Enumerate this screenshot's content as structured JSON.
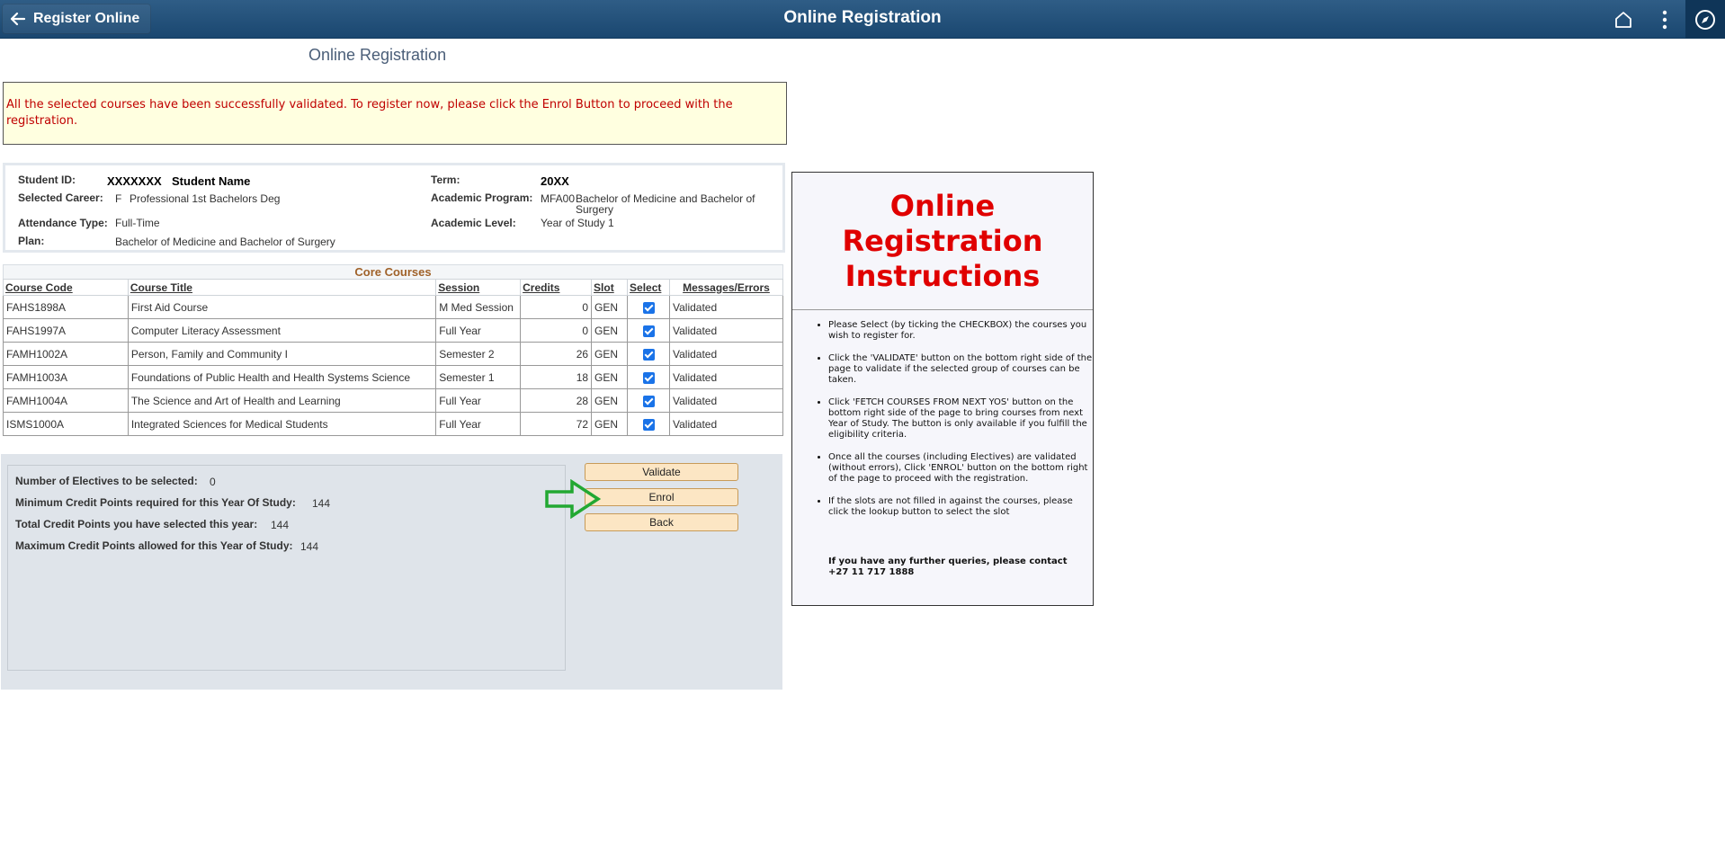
{
  "header": {
    "back_label": "Register Online",
    "title": "Online Registration",
    "icons": [
      "home-icon",
      "more-vertical-icon",
      "compass-icon"
    ]
  },
  "page_title": "Online Registration",
  "message": "All the selected courses have been successfully validated. To register now, please click the Enrol Button to proceed with the registration.",
  "student": {
    "id_label": "Student ID:",
    "id_value": "XXXXXXX",
    "name": "Student Name",
    "career_label": "Selected Career:",
    "career_code": "F",
    "career_value": "Professional 1st Bachelors Deg",
    "attendance_label": "Attendance Type:",
    "attendance_value": "Full-Time",
    "plan_label": "Plan:",
    "plan_value": "Bachelor of Medicine and Bachelor of Surgery",
    "term_label": "Term:",
    "term_value": "20XX",
    "program_label": "Academic Program:",
    "program_code": "MFA00",
    "program_value_line1": "Bachelor of Medicine and Bachelor of",
    "program_value_line2": "Surgery",
    "level_label": "Academic Level:",
    "level_value": "Year of Study 1"
  },
  "core_courses": {
    "title": "Core Courses",
    "headers": [
      "Course Code",
      "Course Title",
      "Session",
      "Credits",
      "Slot",
      "Select",
      "Messages/Errors"
    ],
    "rows": [
      [
        "FAHS1898A",
        "First Aid Course",
        "M Med Session",
        "0",
        "GEN",
        "Validated"
      ],
      [
        "FAHS1997A",
        "Computer Literacy Assessment",
        "Full Year",
        "0",
        "GEN",
        "Validated"
      ],
      [
        "FAMH1002A",
        "Person, Family and Community I",
        "Semester 2",
        "26",
        "GEN",
        "Validated"
      ],
      [
        "FAMH1003A",
        "Foundations of Public Health and Health Systems Science",
        "Semester 1",
        "18",
        "GEN",
        "Validated"
      ],
      [
        "FAMH1004A",
        "The Science and Art of Health and Learning",
        "Full Year",
        "28",
        "GEN",
        "Validated"
      ],
      [
        "ISMS1000A",
        "Integrated Sciences for Medical Students",
        "Full Year",
        "72",
        "GEN",
        "Validated"
      ]
    ]
  },
  "credits": {
    "electives_label": "Number of Electives to be selected:",
    "electives_value": "0",
    "min_label": "Minimum Credit Points required for this Year Of Study:",
    "min_value": "144",
    "total_label": "Total Credit Points you have selected this year:",
    "total_value": "144",
    "max_label": "Maximum Credit Points allowed for this Year of Study:",
    "max_value": "144"
  },
  "buttons": {
    "validate": "Validate",
    "enrol": "Enrol",
    "back": "Back"
  },
  "instructions": {
    "title_line1": "Online",
    "title_line2": "Registration",
    "title_line3": "Instructions",
    "items": [
      "Please Select (by ticking the CHECKBOX) the courses you wish to register for.",
      "Click the 'VALIDATE' button on the bottom right side of the page to validate if the selected group of courses can be taken.",
      "Click 'FETCH COURSES FROM NEXT YOS' button on the bottom right side of the page to bring courses from next Year of Study. The button is only available if you fulfill the eligibility criteria.",
      "Once all the courses (including Electives) are validated (without errors), Click 'ENROL' button on the bottom right of the page to proceed with the registration.",
      "If the slots are not filled in against the courses, please click the lookup button to select the slot"
    ],
    "contact_line1": "If you have any further queries, please contact",
    "contact_line2": "+27 11 717 1888"
  },
  "colors": {
    "header_bg": "#1f4f7a",
    "message_text": "#c00000",
    "message_bg": "#ffffe0",
    "instructions_title": "#e00000",
    "button_bg": "#fce6c4",
    "arrow": "#22a832",
    "checkbox": "#1a73e8"
  }
}
